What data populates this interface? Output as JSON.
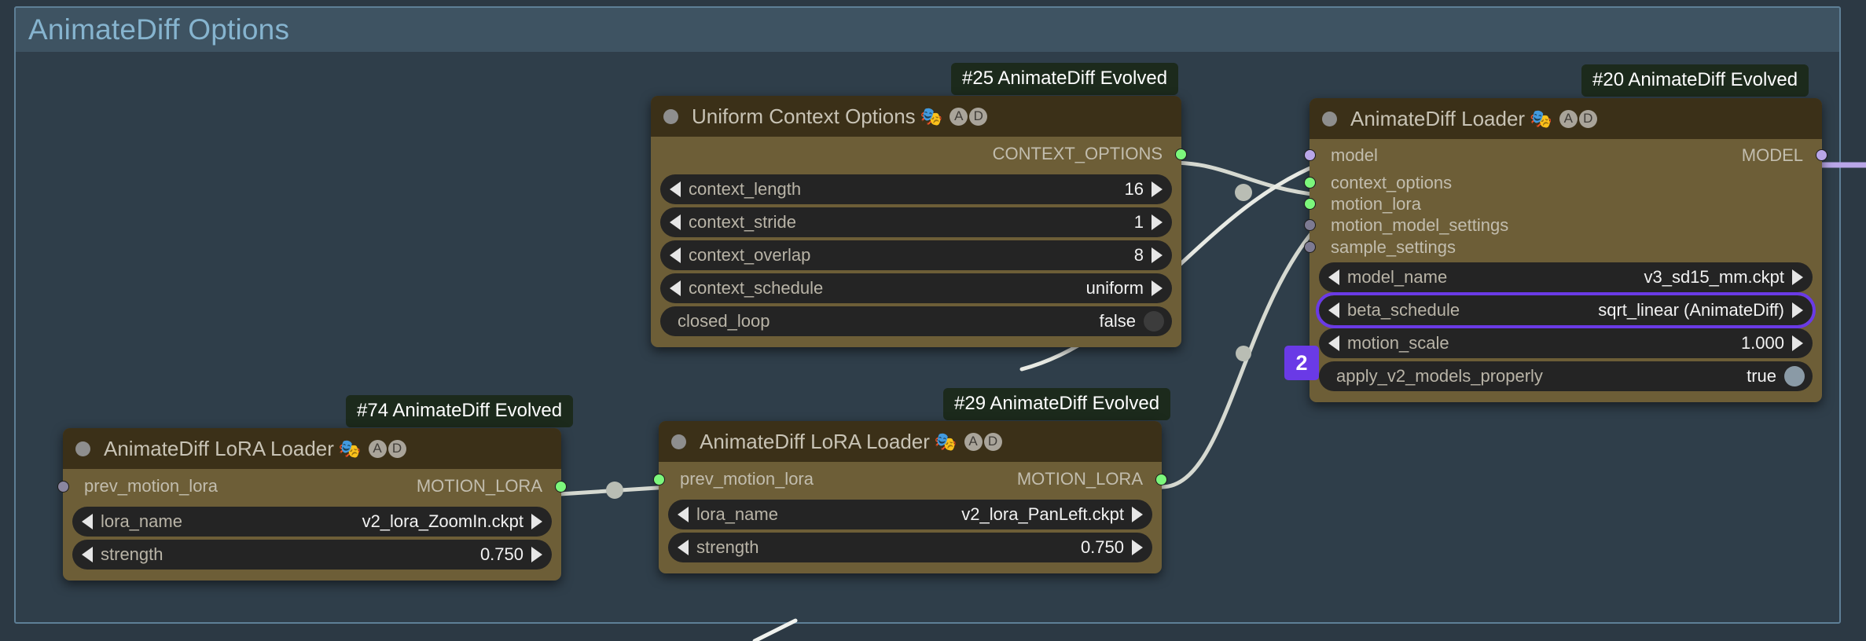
{
  "canvas": {
    "bg_color": "#2c3944",
    "link_color": "#d6d9d1",
    "model_link_color": "#b9a6e8"
  },
  "group": {
    "title": "AnimateDiff Options",
    "title_color": "#86b4cf",
    "border_color": "#5e7f96"
  },
  "nodes": [
    {
      "id_badge": "#25 AnimateDiff Evolved",
      "title": "Uniform Context Options",
      "emoji": "🎭",
      "letters": [
        "A",
        "D"
      ],
      "outputs": [
        {
          "label": "CONTEXT_OPTIONS",
          "color": "#7cf77c"
        }
      ],
      "inputs": [],
      "widgets": [
        {
          "name": "context_length",
          "value": "16",
          "type": "arrows"
        },
        {
          "name": "context_stride",
          "value": "1",
          "type": "arrows"
        },
        {
          "name": "context_overlap",
          "value": "8",
          "type": "arrows"
        },
        {
          "name": "context_schedule",
          "value": "uniform",
          "type": "arrows"
        },
        {
          "name": "closed_loop",
          "value": "false",
          "type": "toggle",
          "knob_color": "#3c3c3c"
        }
      ]
    },
    {
      "id_badge": "#20 AnimateDiff Evolved",
      "title": "AnimateDiff Loader",
      "emoji": "🎭",
      "letters": [
        "A",
        "D"
      ],
      "inputs": [
        {
          "label": "model",
          "color": "#b9a6e8"
        },
        {
          "label": "context_options",
          "color": "#7cf77c"
        },
        {
          "label": "motion_lora",
          "color": "#7cf77c"
        },
        {
          "label": "motion_model_settings",
          "color": "#7d7a92"
        },
        {
          "label": "sample_settings",
          "color": "#7d7a92"
        }
      ],
      "outputs": [
        {
          "label": "MODEL",
          "color": "#b9a6e8"
        }
      ],
      "widgets": [
        {
          "name": "model_name",
          "value": "v3_sd15_mm.ckpt",
          "type": "arrows"
        },
        {
          "name": "beta_schedule",
          "value": "sqrt_linear (AnimateDiff)",
          "type": "arrows",
          "highlight": true,
          "marker": "2",
          "marker_color": "#6a3ae6"
        },
        {
          "name": "motion_scale",
          "value": "1.000",
          "type": "arrows"
        },
        {
          "name": "apply_v2_models_properly",
          "value": "true",
          "type": "toggle",
          "knob_color": "#8a9aa6"
        }
      ]
    },
    {
      "id_badge": "#74 AnimateDiff Evolved",
      "title": "AnimateDiff LoRA Loader",
      "emoji": "🎭",
      "letters": [
        "A",
        "D"
      ],
      "inputs": [
        {
          "label": "prev_motion_lora",
          "color": "#8a86a0"
        }
      ],
      "outputs": [
        {
          "label": "MOTION_LORA",
          "color": "#7cf77c"
        }
      ],
      "widgets": [
        {
          "name": "lora_name",
          "value": "v2_lora_ZoomIn.ckpt",
          "type": "arrows"
        },
        {
          "name": "strength",
          "value": "0.750",
          "type": "arrows"
        }
      ]
    },
    {
      "id_badge": "#29 AnimateDiff Evolved",
      "title": "AnimateDiff LoRA Loader",
      "emoji": "🎭",
      "letters": [
        "A",
        "D"
      ],
      "inputs": [
        {
          "label": "prev_motion_lora",
          "color": "#7cf77c"
        }
      ],
      "outputs": [
        {
          "label": "MOTION_LORA",
          "color": "#7cf77c"
        }
      ],
      "widgets": [
        {
          "name": "lora_name",
          "value": "v2_lora_PanLeft.ckpt",
          "type": "arrows"
        },
        {
          "name": "strength",
          "value": "0.750",
          "type": "arrows"
        }
      ]
    }
  ]
}
